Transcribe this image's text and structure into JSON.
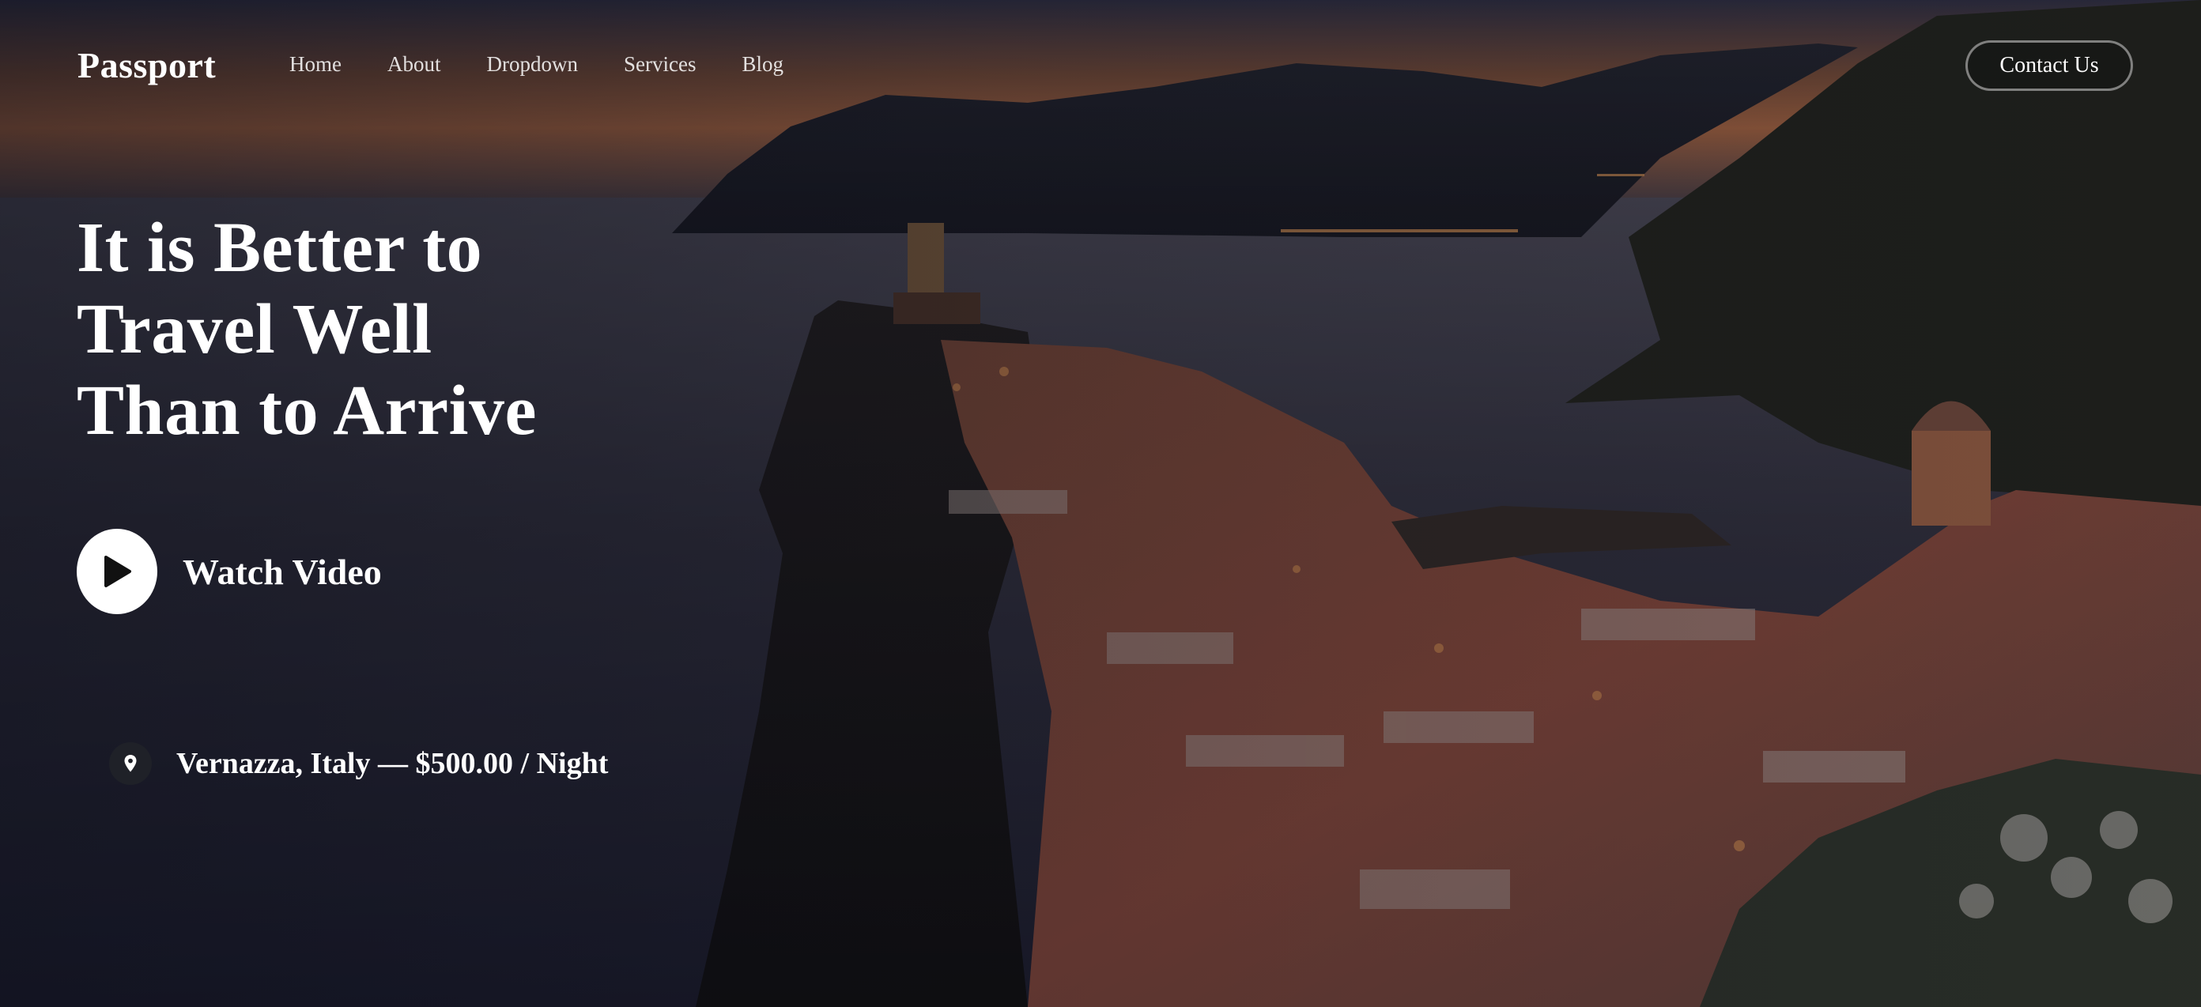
{
  "navbar": {
    "brand": "Passport",
    "links": [
      "Home",
      "About",
      "Dropdown",
      "Services",
      "Blog"
    ],
    "contact_label": "Contact Us"
  },
  "hero": {
    "headline_lines": [
      "It is Better to",
      "Travel Well",
      "Than to Arrive"
    ],
    "watch_video_label": "Watch Video",
    "play_icon": "play-icon",
    "location_icon": "location-pin-icon",
    "location_text": "Vernazza, Italy — $500.00 / Night"
  },
  "colors": {
    "text": "#ffffff",
    "play_button_bg": "#ffffff",
    "pin_bg": "#1f2128",
    "contact_border": "rgba(255,255,255,0.45)"
  }
}
